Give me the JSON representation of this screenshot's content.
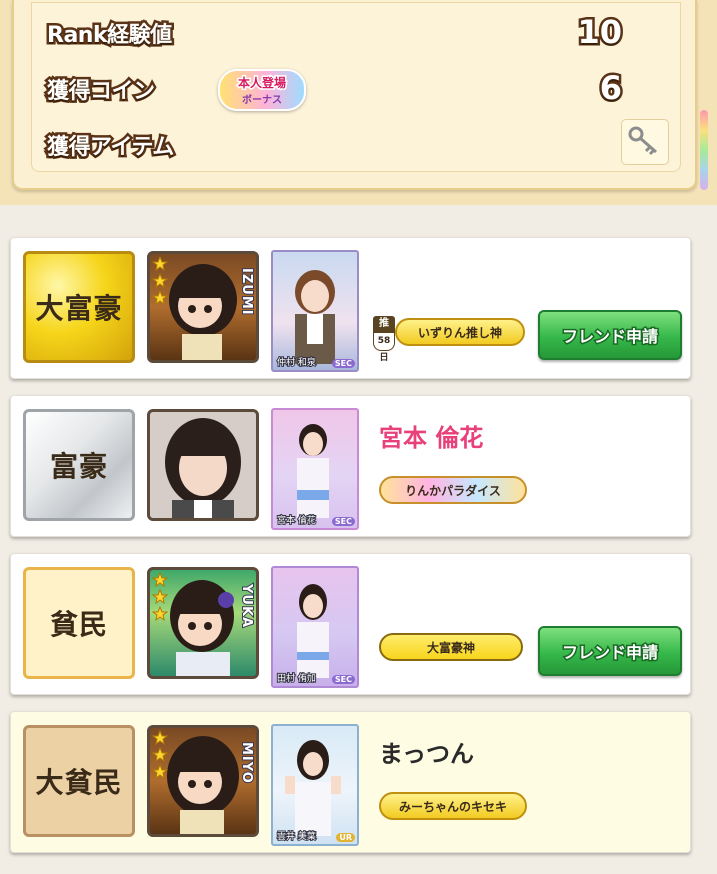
{
  "results": {
    "rank_exp_label": "Rank経験値",
    "rank_exp_value": "10",
    "coins_label": "獲得コイン",
    "coins_value": "6",
    "bonus_badge_top": "本人登場",
    "bonus_badge_bottom": "ボーナス",
    "items_label": "獲得アイテム",
    "item_icon": "key-icon"
  },
  "players": [
    {
      "rank": "大富豪",
      "avatar_name": "IZUMI",
      "card_name": "仲村 和泉",
      "card_rarity": "SEC",
      "name": "",
      "oshi_label": "推",
      "oshi_days": "58日",
      "title": "いずりん推し神",
      "friend_button": "フレンド申請"
    },
    {
      "rank": "富豪",
      "card_name": "宮本 倫花",
      "card_rarity": "SEC",
      "name": "宮本 倫花",
      "name_color": "#e8407a",
      "title": "りんかパラダイス"
    },
    {
      "rank": "貧民",
      "avatar_name": "YUKA",
      "card_name": "田村 侑加",
      "card_rarity": "SEC",
      "name": "",
      "title": "大富豪神",
      "friend_button": "フレンド申請"
    },
    {
      "rank": "大貧民",
      "avatar_name": "MIYO",
      "card_name": "雲井 美葉",
      "card_rarity": "UR",
      "name": "まっつん",
      "title": "みーちゃんのキセキ"
    }
  ],
  "colors": {
    "panel_bg": "#fbf0d2",
    "friend_button_green": "#36b84a",
    "self_row_bg": "#fefce3"
  }
}
